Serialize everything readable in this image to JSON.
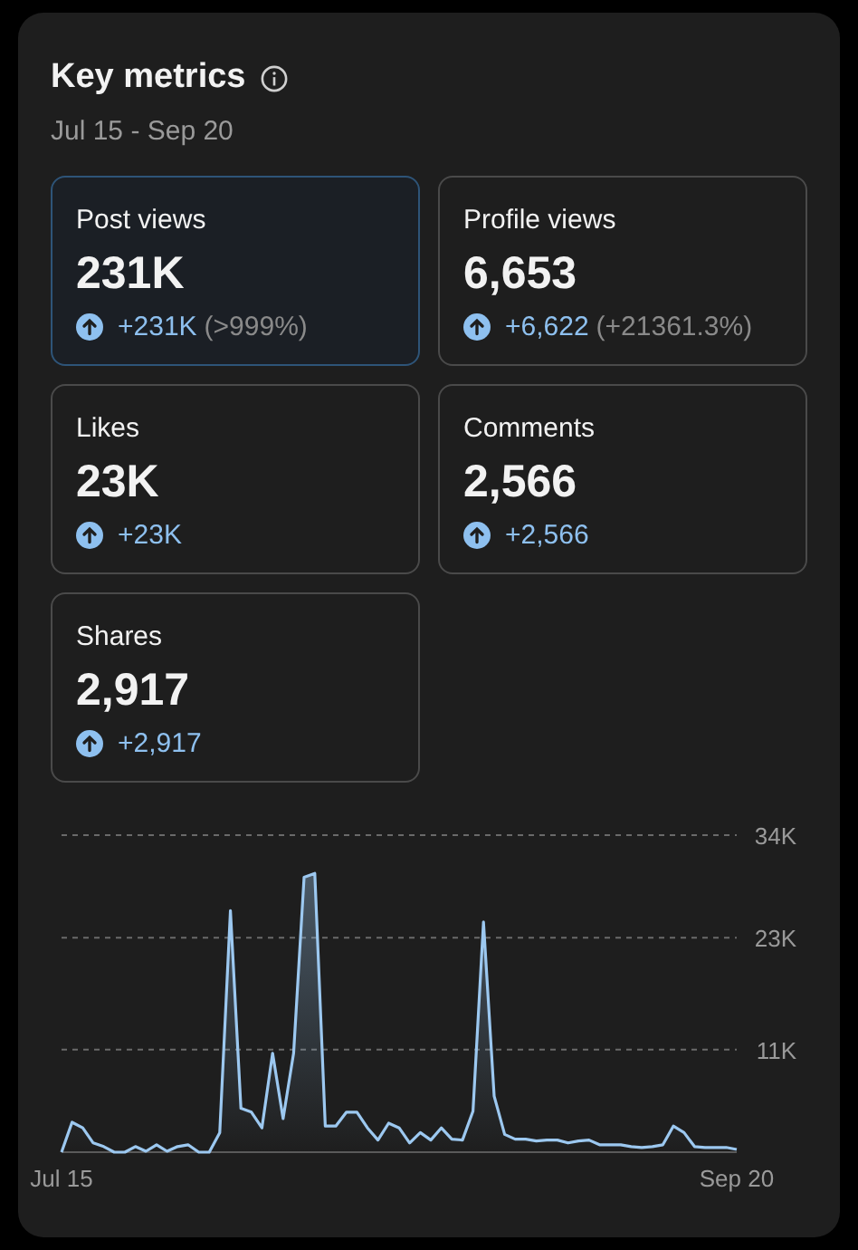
{
  "card": {
    "title": "Key metrics",
    "date_range": "Jul 15 - Sep 20"
  },
  "metrics": [
    {
      "label": "Post views",
      "value": "231K",
      "change": "+231K",
      "percent": "(>999%)",
      "selected": true
    },
    {
      "label": "Profile views",
      "value": "6,653",
      "change": "+6,622",
      "percent": "(+21361.3%)",
      "selected": false
    },
    {
      "label": "Likes",
      "value": "23K",
      "change": "+23K",
      "selected": false
    },
    {
      "label": "Comments",
      "value": "2,566",
      "change": "+2,566",
      "selected": false
    },
    {
      "label": "Shares",
      "value": "2,917",
      "change": "+2,917",
      "selected": false
    }
  ],
  "chart": {
    "chart_data": {
      "type": "area",
      "ylim": [
        0,
        34
      ],
      "categories": [
        "Jul 15",
        null,
        null,
        null,
        null,
        null,
        null,
        null,
        null,
        null,
        null,
        null,
        null,
        null,
        null,
        null,
        null,
        null,
        null,
        null,
        null,
        null,
        null,
        null,
        null,
        null,
        null,
        null,
        null,
        null,
        null,
        null,
        null,
        null,
        null,
        null,
        null,
        null,
        null,
        null,
        null,
        null,
        null,
        null,
        null,
        null,
        null,
        null,
        null,
        null,
        null,
        null,
        null,
        null,
        null,
        null,
        null,
        null,
        null,
        null,
        null,
        null,
        null,
        null,
        "Sep 20"
      ],
      "yticks": [
        {
          "value": 11,
          "label": "11K"
        },
        {
          "value": 23,
          "label": "23K"
        },
        {
          "value": 34,
          "label": "34K"
        }
      ],
      "series": [
        {
          "color": "#9cc8f0",
          "values": [
            0,
            3.2,
            2.6,
            1.0,
            0.6,
            0,
            0,
            0.6,
            0.1,
            0.8,
            0.1,
            0.6,
            0.8,
            0,
            0,
            2.1,
            25.9,
            4.7,
            4.3,
            2.6,
            10.6,
            3.6,
            10.6,
            29.5,
            29.9,
            2.8,
            2.8,
            4.3,
            4.3,
            2.6,
            1.3,
            3.1,
            2.6,
            1.0,
            2.1,
            1.3,
            2.6,
            1.4,
            1.3,
            4.4,
            24.7,
            6.0,
            1.9,
            1.4,
            1.4,
            1.2,
            1.3,
            1.3,
            1.0,
            1.2,
            1.3,
            0.8,
            0.8,
            0.8,
            0.6,
            0.5,
            0.6,
            0.8,
            2.8,
            2.1,
            0.6,
            0.5,
            0.5,
            0.5,
            0.3
          ]
        }
      ]
    }
  }
}
